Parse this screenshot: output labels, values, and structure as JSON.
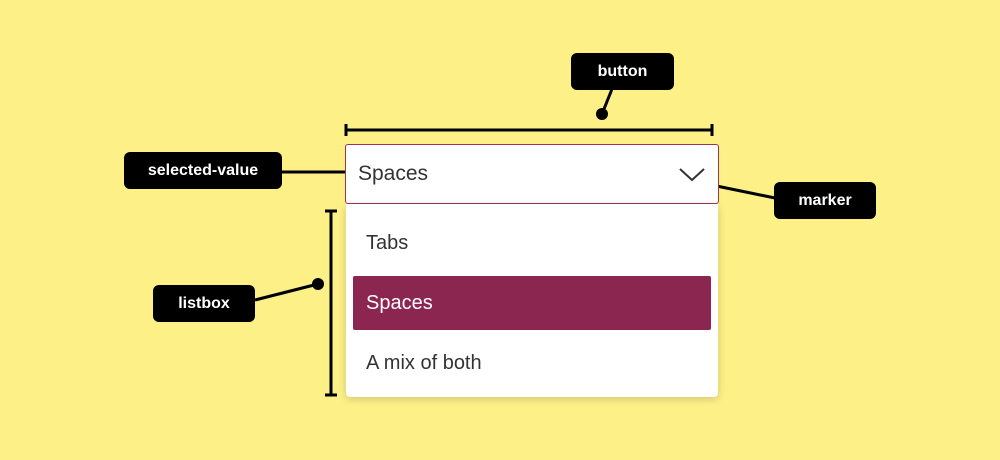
{
  "callouts": {
    "button": "button",
    "selected_value": "selected-value",
    "marker": "marker",
    "listbox": "listbox"
  },
  "select": {
    "selected_value": "Spaces",
    "marker_icon": "chevron-down-icon",
    "options": [
      {
        "label": "Tabs",
        "selected": false
      },
      {
        "label": "Spaces",
        "selected": true
      },
      {
        "label": "A mix of both",
        "selected": false
      }
    ]
  },
  "colors": {
    "background": "#fdf087",
    "callout": "#000000",
    "accent": "#8b2650",
    "border": "#a1334f"
  }
}
